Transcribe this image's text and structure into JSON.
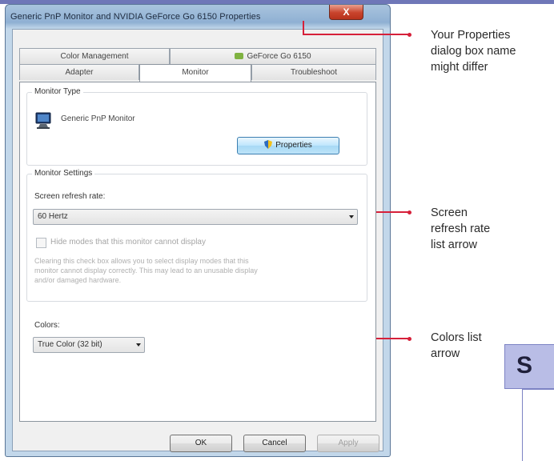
{
  "window": {
    "title": "Generic PnP Monitor and NVIDIA GeForce Go 6150 Properties",
    "close_label": "X"
  },
  "tabs": {
    "row1": [
      {
        "label": "Color Management"
      },
      {
        "label": "GeForce Go 6150"
      }
    ],
    "row2": [
      {
        "label": "Adapter"
      },
      {
        "label": "Monitor"
      },
      {
        "label": "Troubleshoot"
      }
    ],
    "active": "Monitor"
  },
  "monitor_type": {
    "group_label": "Monitor Type",
    "monitor_name": "Generic PnP Monitor",
    "properties_button": "Properties"
  },
  "monitor_settings": {
    "group_label": "Monitor Settings",
    "refresh_label": "Screen refresh rate:",
    "refresh_value": "60 Hertz",
    "hide_modes_label": "Hide modes that this monitor cannot display",
    "hide_modes_checked": false,
    "help_line1": "Clearing this check box allows you to select display modes that this",
    "help_line2": "monitor cannot display correctly. This may lead to an unusable display",
    "help_line3": "and/or damaged hardware."
  },
  "colors": {
    "label": "Colors:",
    "value": "True Color (32 bit)"
  },
  "buttons": {
    "ok": "OK",
    "cancel": "Cancel",
    "apply": "Apply"
  },
  "callouts": {
    "properties_name": [
      "Your Properties",
      "dialog box name",
      "might differ"
    ],
    "refresh_arrow": [
      "Screen",
      "refresh rate",
      "list arrow"
    ],
    "colors_arrow": [
      "Colors list",
      "arrow"
    ]
  },
  "slide_fragment": {
    "letter": "S"
  },
  "colors_theme": {
    "callout_line": "#d6203a",
    "slide_box": "#b9bde6",
    "top_bar": "#6f77b8"
  }
}
